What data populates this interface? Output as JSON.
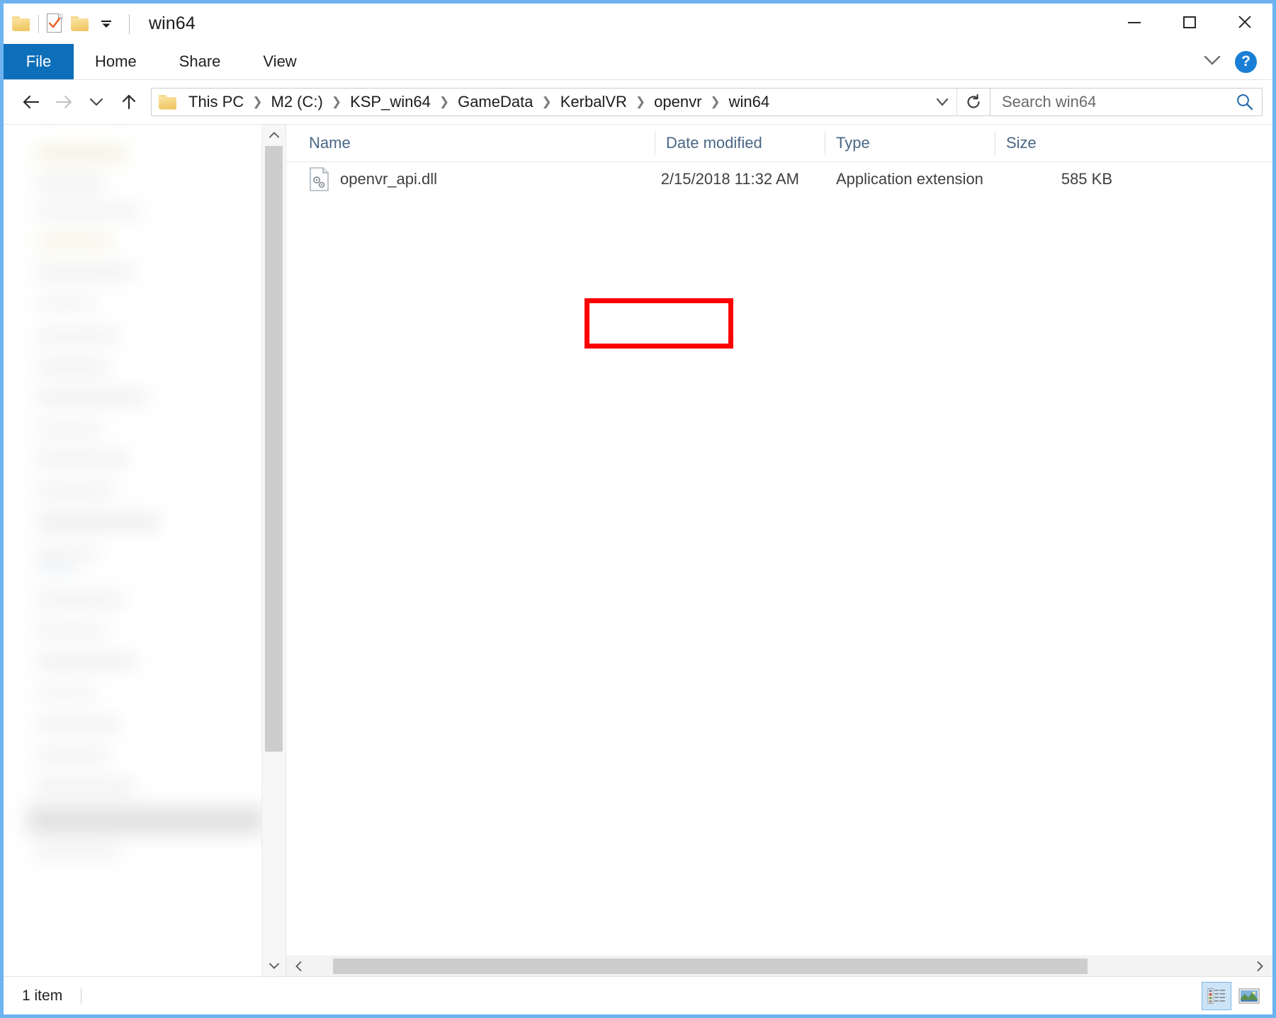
{
  "window": {
    "title": "win64",
    "minimize_label": "Minimize",
    "maximize_label": "Maximize",
    "close_label": "Close"
  },
  "quick_access": {
    "folder_label": "Explorer",
    "properties_label": "Properties",
    "new_folder_label": "New folder",
    "customize_label": "Customize Quick Access Toolbar"
  },
  "ribbon": {
    "tabs": [
      {
        "label": "File",
        "active": true
      },
      {
        "label": "Home",
        "active": false
      },
      {
        "label": "Share",
        "active": false
      },
      {
        "label": "View",
        "active": false
      }
    ],
    "expand_label": "Expand the Ribbon",
    "help_label": "?"
  },
  "navigation": {
    "back_label": "Back",
    "forward_label": "Forward",
    "recent_label": "Recent locations",
    "up_label": "Up"
  },
  "address": {
    "crumbs": [
      "This PC",
      "M2 (C:)",
      "KSP_win64",
      "GameData",
      "KerbalVR",
      "openvr",
      "win64"
    ],
    "separator": "❯",
    "dropdown_label": "Previous locations",
    "refresh_label": "Refresh"
  },
  "search": {
    "placeholder": "Search win64",
    "value": "",
    "icon_label": "Search"
  },
  "columns": [
    {
      "key": "name",
      "label": "Name"
    },
    {
      "key": "date",
      "label": "Date modified"
    },
    {
      "key": "type",
      "label": "Type"
    },
    {
      "key": "size",
      "label": "Size"
    }
  ],
  "files": [
    {
      "name": "openvr_api.dll",
      "date": "2/15/2018 11:32 AM",
      "type": "Application extension",
      "size": "585 KB",
      "highlighted": true
    }
  ],
  "status": {
    "item_count": "1 item"
  },
  "view_toggles": {
    "details_label": "Details view",
    "large_icons_label": "Large icons view",
    "active": "details"
  },
  "colors": {
    "accent": "#0d6fba",
    "window_border": "#6cb3f0",
    "highlight_box": "#fc0000",
    "column_header_text": "#4a6785",
    "help_button": "#1a7fd4"
  }
}
